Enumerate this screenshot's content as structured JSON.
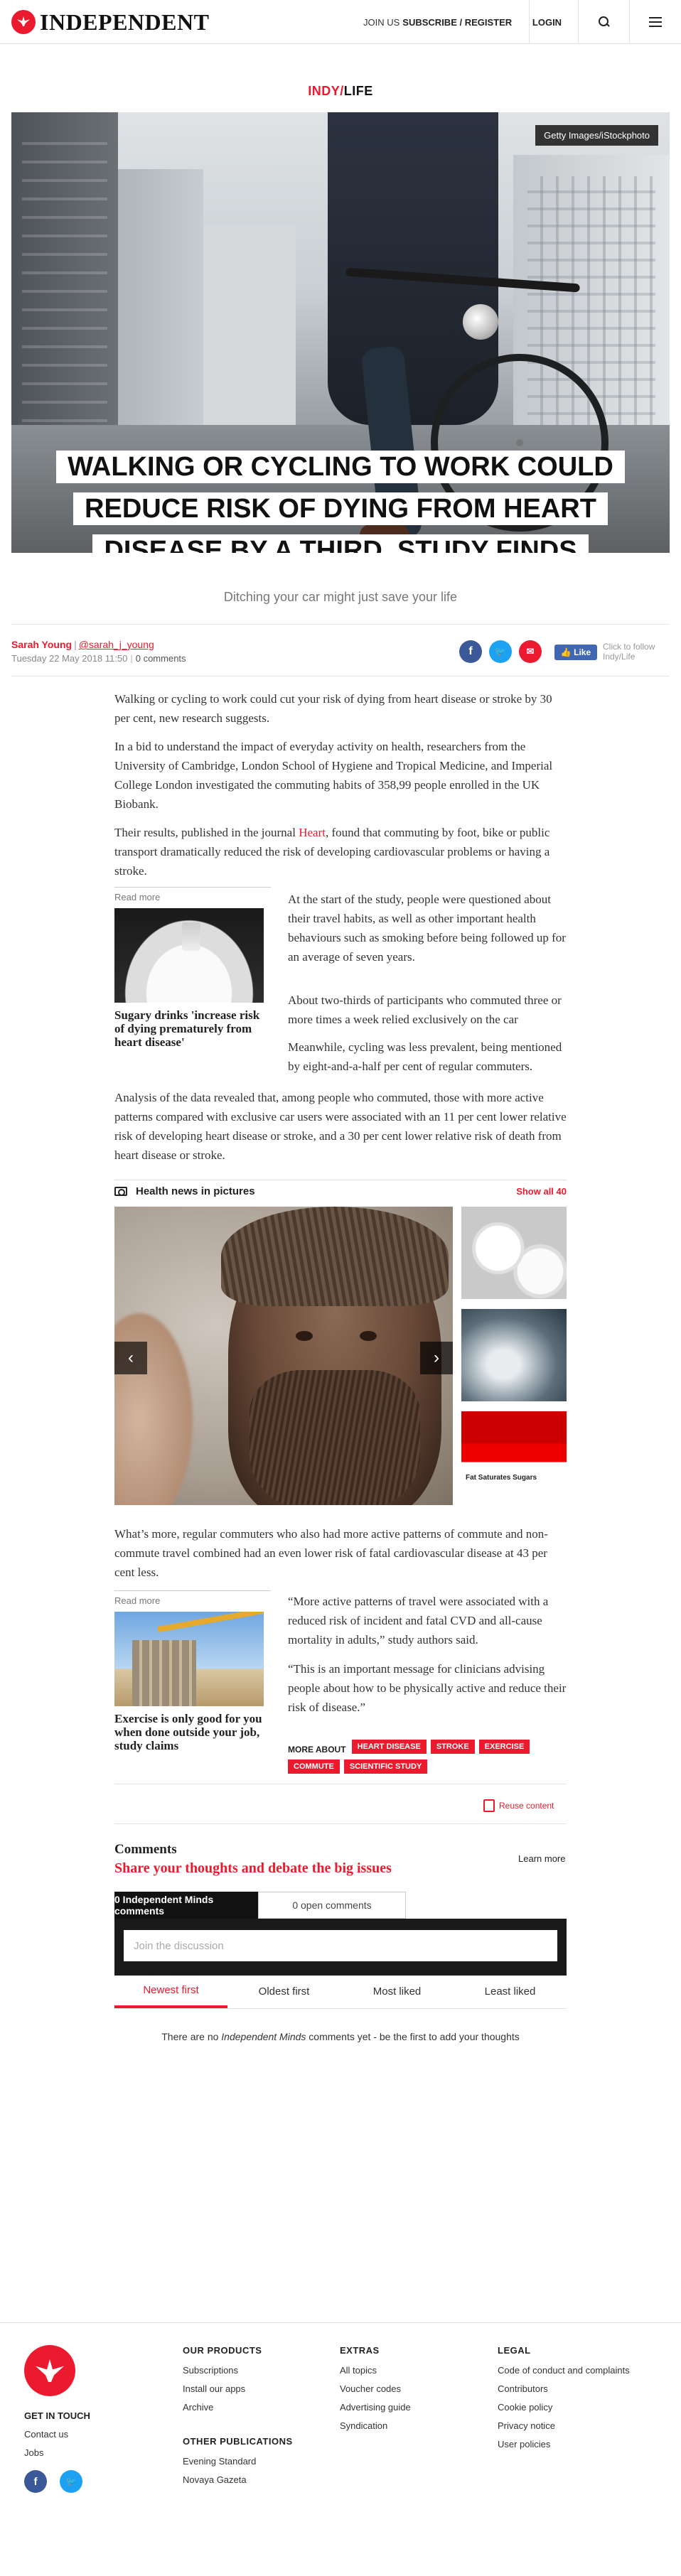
{
  "header": {
    "logo_text": "INDEPENDENT",
    "join_us": "JOIN US",
    "subscribe_register": "SUBSCRIBE / REGISTER",
    "login": "LOGIN",
    "search_icon": "search-icon",
    "menu_icon": "hamburger-menu-icon"
  },
  "section": {
    "part1": "INDY",
    "slash": "/",
    "part2": "LIFE"
  },
  "hero": {
    "photo_credit": "Getty Images/iStockphoto",
    "headline": "Walking or cycling to work could reduce risk of dying from heart disease by a third, study finds"
  },
  "standfirst": "Ditching your car might just save your life",
  "byline": {
    "author": "Sarah Young",
    "separator": "|",
    "handle": "@sarah_j_young",
    "date": "Tuesday 22 May 2018 11:50",
    "comments_count": "0 comments",
    "like_label": "Like",
    "follow_text": "Click to follow Indy/Life"
  },
  "article": {
    "p1": "Walking or cycling to work could cut your risk of dying from heart disease or stroke by 30 per cent, new research suggests.",
    "p2": "In a bid to understand the impact of everyday activity on health, researchers from the University of Cambridge, London School of Hygiene and Tropical Medicine, and Imperial College London investigated the commuting habits of 358,99 people enrolled in the UK Biobank.",
    "p3_before": "Their results, published in the journal ",
    "p3_link": "Heart",
    "p3_after": ", found that commuting by foot, bike or public transport dramatically reduced the risk of developing cardiovascular problems or having a stroke.",
    "p4": "At the start of the study, people were questioned about their travel habits, as well as other important health behaviours such as smoking before being followed up for an average of seven years.",
    "p5": "About two-thirds of participants who commuted three or more times a week relied exclusively on the car",
    "p6": "Meanwhile, cycling was less prevalent, being mentioned by eight-and-a-half per cent of regular commuters.",
    "p7": "Analysis of the data revealed that, among people who commuted, those with more active patterns compared with exclusive car users were associated with an 11 per cent lower relative risk of developing heart disease or stroke, and a 30 per cent lower relative risk of death from heart disease or stroke.",
    "p8": "What’s more, regular commuters who also had more active patterns of commute and non-commute travel combined had an even lower risk of fatal cardiovascular disease at 43 per cent less.",
    "p9": "“More active patterns of travel were associated with a reduced risk of incident and fatal CVD and all-cause mortality in adults,” study authors said.",
    "p10": "“This is an important message for clinicians advising people about how to be physically active and reduce their risk of disease.”"
  },
  "read_more_1": {
    "label": "Read more",
    "title": "Sugary drinks 'increase risk of dying prematurely from heart disease'"
  },
  "read_more_2": {
    "label": "Read more",
    "title": "Exercise is only good for you when done outside your job, study claims"
  },
  "gallery": {
    "title": "Health news in pictures",
    "show_all": "Show all 40",
    "prev_label": "‹",
    "next_label": "›"
  },
  "more_about": {
    "label": "MORE ABOUT",
    "tags": [
      "HEART DISEASE",
      "STROKE",
      "EXERCISE",
      "COMMUTE",
      "SCIENTIFIC STUDY"
    ]
  },
  "reuse_content": "Reuse content",
  "comments": {
    "title": "Comments",
    "subtitle": "Share your thoughts and debate the big issues",
    "learn_more": "Learn more",
    "tab_active": "0 Independent Minds comments",
    "tab_inactive": "0 open comments",
    "input_placeholder": "Join the discussion",
    "sort": [
      "Newest first",
      "Oldest first",
      "Most liked",
      "Least liked"
    ],
    "empty_before": "There are no ",
    "empty_em": "Independent Minds",
    "empty_after": " comments yet - be the first to add your thoughts"
  },
  "footer": {
    "get_in_touch": "GET IN TOUCH",
    "contact_us": "Contact us",
    "jobs": "Jobs",
    "our_products": "OUR PRODUCTS",
    "products": [
      "Subscriptions",
      "Install our apps",
      "Archive"
    ],
    "other_publications": "OTHER PUBLICATIONS",
    "publications": [
      "Evening Standard",
      "Novaya Gazeta"
    ],
    "extras": "EXTRAS",
    "extras_links": [
      "All topics",
      "Voucher codes",
      "Advertising guide",
      "Syndication"
    ],
    "legal": "LEGAL",
    "legal_links": [
      "Code of conduct and complaints",
      "Contributors",
      "Cookie policy",
      "Privacy notice",
      "User policies"
    ]
  }
}
